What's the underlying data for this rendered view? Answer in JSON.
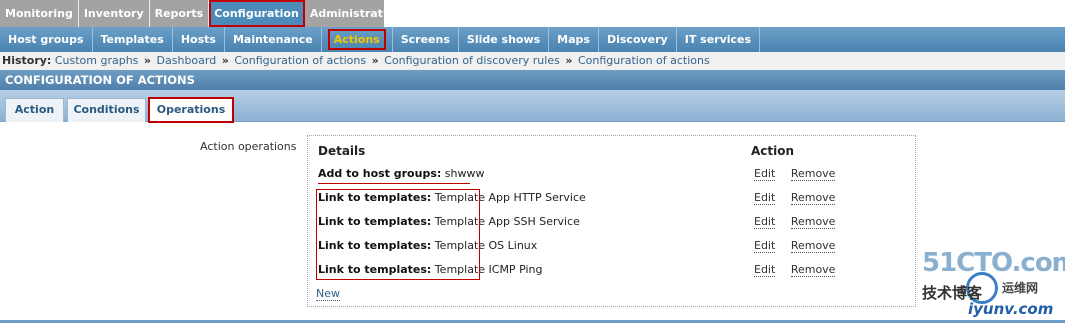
{
  "main_menu": [
    "Monitoring",
    "Inventory",
    "Reports",
    "Configuration",
    "Administration"
  ],
  "main_menu_active": "Configuration",
  "sub_menu": [
    "Host groups",
    "Templates",
    "Hosts",
    "Maintenance",
    "Actions",
    "Screens",
    "Slide shows",
    "Maps",
    "Discovery",
    "IT services"
  ],
  "sub_menu_active": "Actions",
  "history": {
    "label": "History:",
    "items": [
      "Custom graphs",
      "Dashboard",
      "Configuration of actions",
      "Configuration of discovery rules",
      "Configuration of actions"
    ],
    "separator": "»"
  },
  "page_header": "CONFIGURATION OF ACTIONS",
  "tabs": [
    "Action",
    "Conditions",
    "Operations"
  ],
  "tabs_active": "Operations",
  "form": {
    "label": "Action operations",
    "details_header": "Details",
    "action_header": "Action",
    "operations": [
      {
        "type": "Add to host groups:",
        "value": "shwww"
      },
      {
        "type": "Link to templates:",
        "value": "Template App HTTP Service"
      },
      {
        "type": "Link to templates:",
        "value": "Template App SSH Service"
      },
      {
        "type": "Link to templates:",
        "value": "Template OS Linux"
      },
      {
        "type": "Link to templates:",
        "value": "Template ICMP Ping"
      }
    ],
    "edit_label": "Edit",
    "remove_label": "Remove",
    "new_label": "New"
  },
  "watermark": {
    "brand": "51CTO.com",
    "cn_text": "技术博客",
    "cn_small": "运维网",
    "url": "iyunv.com"
  },
  "colors": {
    "accent_blue": "#4a83b0",
    "highlight_red": "#c00000",
    "active_submenu": "#f5c400"
  }
}
